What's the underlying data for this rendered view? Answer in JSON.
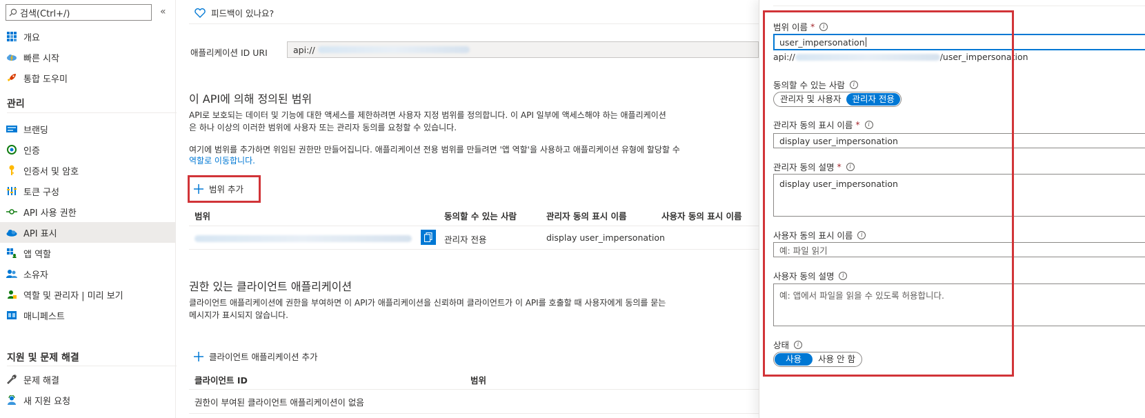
{
  "sidebar": {
    "search_placeholder": "검색(Ctrl+/)",
    "collapse": "«",
    "items_top": [
      {
        "label": "개요",
        "icon": "grid-icon"
      },
      {
        "label": "빠른 시작",
        "icon": "cloud-lightning-icon"
      },
      {
        "label": "통합 도우미",
        "icon": "rocket-icon"
      }
    ],
    "section_manage": "관리",
    "items_manage": [
      {
        "label": "브랜딩",
        "icon": "branding-icon"
      },
      {
        "label": "인증",
        "icon": "authentication-icon"
      },
      {
        "label": "인증서 및 암호",
        "icon": "key-icon"
      },
      {
        "label": "토큰 구성",
        "icon": "token-bars-icon"
      },
      {
        "label": "API 사용 권한",
        "icon": "api-permissions-icon"
      },
      {
        "label": "API 표시",
        "icon": "cloud-icon"
      },
      {
        "label": "앱 역할",
        "icon": "app-roles-icon"
      },
      {
        "label": "소유자",
        "icon": "owners-icon"
      },
      {
        "label": "역할 및 관리자 | 미리 보기",
        "icon": "roles-admins-icon"
      },
      {
        "label": "매니페스트",
        "icon": "manifest-icon"
      }
    ],
    "section_support": "지원 및 문제 해결",
    "items_support": [
      {
        "label": "문제 해결",
        "icon": "wrench-icon"
      },
      {
        "label": "새 지원 요청",
        "icon": "support-person-icon"
      }
    ]
  },
  "main": {
    "feedback": "피드백이 있나요?",
    "app_id_uri_label": "애플리케이션 ID URI",
    "app_id_uri_value": "api://",
    "scopes_title": "이 API에 의해 정의된 범위",
    "scopes_desc1": "API로 보호되는 데이터 및 기능에 대한 액세스를 제한하려면 사용자 지정 범위를 정의합니다. 이 API 일부에 액세스해야 하는 애플리케이션",
    "scopes_desc2": "은 하나 이상의 이러한 범위에 사용자 또는 관리자 동의를 요청할 수 있습니다.",
    "scopes_desc3": "여기에 범위를 추가하면 위임된 권한만 만들어집니다. 애플리케이션 전용 범위를 만들려면 '앱 역할'을 사용하고 애플리케이션 유형에 할당할 수",
    "scopes_link": "역할로 이동합니다.",
    "add_scope": "범위 추가",
    "table_headers": [
      "범위",
      "동의할 수 있는 사람",
      "관리자 동의 표시 이름",
      "사용자 동의 표시 이름"
    ],
    "row": {
      "who": "관리자 전용",
      "admin_display": "display user_impersonation"
    },
    "clients_title": "권한 있는 클라이언트 애플리케이션",
    "clients_desc1": "클라이언트 애플리케이션에 권한을 부여하면 이 API가 애플리케이션을 신뢰하며 클라이언트가 이 API를 호출할 때 사용자에게 동의를 묻는",
    "clients_desc2": "메시지가 표시되지 않습니다.",
    "add_client": "클라이언트 애플리케이션 추가",
    "client_headers": [
      "클라이언트 ID",
      "범위"
    ],
    "client_empty": "권한이 부여된 클라이언트 애플리케이션이 없음"
  },
  "panel": {
    "scope_name_label": "범위 이름",
    "scope_name_value": "user_impersonation",
    "scope_uri_prefix": "api://",
    "scope_uri_suffix": "/user_impersonation",
    "who_label": "동의할 수 있는 사람",
    "who_options": [
      "관리자 및 사용자",
      "관리자 전용"
    ],
    "admin_display_label": "관리자 동의 표시 이름",
    "admin_display_value": "display user_impersonation",
    "admin_desc_label": "관리자 동의 설명",
    "admin_desc_value": "display user_impersonation",
    "user_display_label": "사용자 동의 표시 이름",
    "user_display_placeholder": "예: 파일 읽기",
    "user_desc_label": "사용자 동의 설명",
    "user_desc_placeholder": "예: 앱에서 파일을 읽을 수 있도록 허용합니다.",
    "state_label": "상태",
    "state_options": [
      "사용",
      "사용 안 함"
    ],
    "required_mark": "*",
    "info_glyph": "i"
  },
  "colors": {
    "accent": "#0078d4",
    "highlight": "#d13438"
  }
}
